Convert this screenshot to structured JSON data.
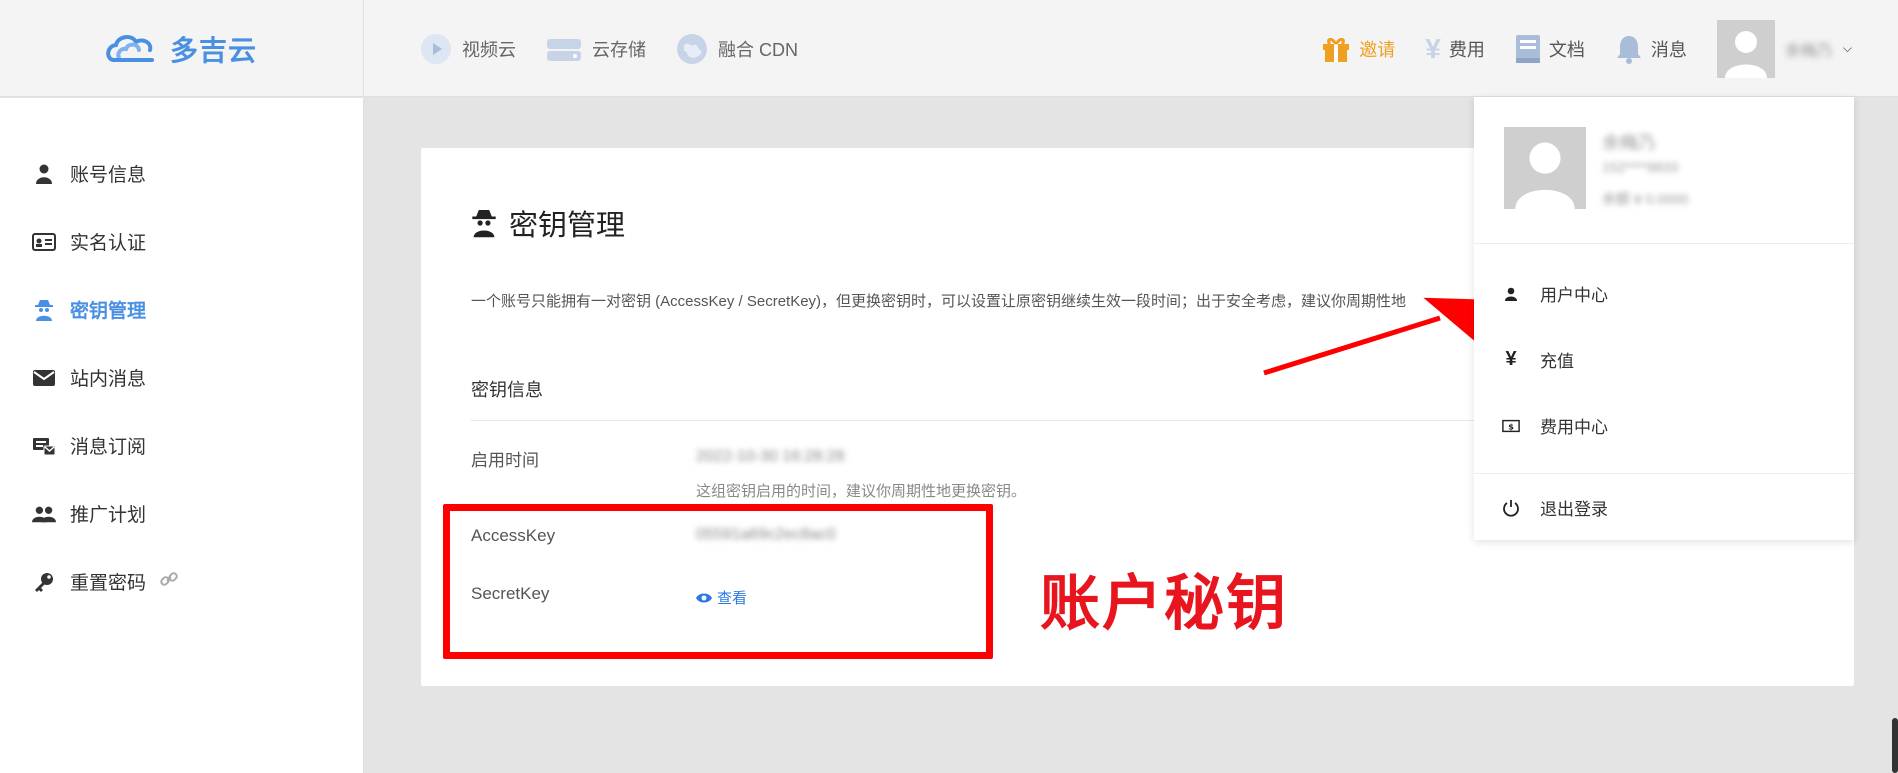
{
  "header": {
    "logo_text": "多吉云",
    "nav": [
      {
        "label": "视频云",
        "icon": "play-icon"
      },
      {
        "label": "云存储",
        "icon": "storage-icon"
      },
      {
        "label": "融合 CDN",
        "icon": "globe-icon"
      }
    ],
    "invite": "邀请",
    "fees": "费用",
    "docs": "文档",
    "messages": "消息",
    "username": "余梅乃"
  },
  "sidebar": {
    "items": [
      {
        "label": "账号信息",
        "icon": "user-icon"
      },
      {
        "label": "实名认证",
        "icon": "id-card-icon"
      },
      {
        "label": "密钥管理",
        "icon": "spy-icon",
        "active": true
      },
      {
        "label": "站内消息",
        "icon": "envelope-icon"
      },
      {
        "label": "消息订阅",
        "icon": "subscribe-icon"
      },
      {
        "label": "推广计划",
        "icon": "users-icon"
      },
      {
        "label": "重置密码",
        "icon": "key-icon"
      }
    ]
  },
  "main": {
    "title": "密钥管理",
    "description": "一个账号只能拥有一对密钥 (AccessKey / SecretKey)，但更换密钥时，可以设置让原密钥继续生效一段时间；出于安全考虑，建议你周期性地",
    "section_title": "密钥信息",
    "start_time_label": "启用时间",
    "start_time_value": "2022-10-30 16:28:28",
    "start_time_hint": "这组密钥启用的时间，建议你周期性地更换密钥。",
    "accesskey_label": "AccessKey",
    "accesskey_value": "05591a69c2ec8ac0",
    "secretkey_label": "SecretKey",
    "view_label": "查看"
  },
  "annotation": {
    "text": "账户秘钥",
    "color": "#e8141e"
  },
  "dropdown": {
    "name": "余梅乃",
    "phone": "152****9833",
    "balance": "余额 ¥ 0.0000",
    "items": [
      {
        "label": "用户中心",
        "icon": "person-icon"
      },
      {
        "label": "充值",
        "icon": "yen-icon"
      },
      {
        "label": "费用中心",
        "icon": "bill-icon"
      },
      {
        "label": "退出登录",
        "icon": "power-icon"
      }
    ]
  },
  "colors": {
    "accent": "#4a90e2",
    "invite": "#f0a020",
    "highlight": "#ff0000"
  }
}
